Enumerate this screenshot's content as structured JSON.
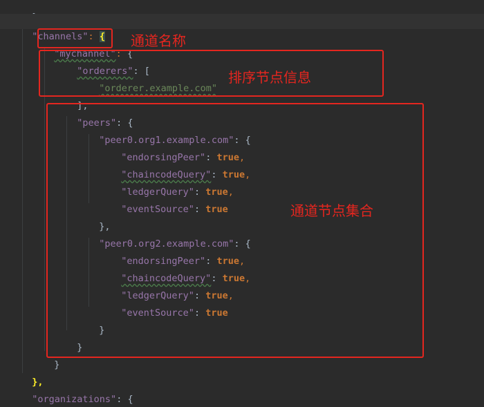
{
  "editor": {
    "lines": {
      "l0_close": "},",
      "l1_channels_key": "\"channels\"",
      "l1_colon": ": ",
      "l1_brace": "{",
      "l2_mychannel_key": "\"mychannel\"",
      "l2_colon": ": ",
      "l2_brace": "{",
      "l3_orderers_key": "\"orderers\"",
      "l3_rest": ": [",
      "l4_orderer_value": "\"orderer.example.com\"",
      "l5_close": "],",
      "l6_peers_key": "\"peers\"",
      "l6_rest": ": {",
      "l7_peer1_key": "\"peer0.org1.example.com\"",
      "l7_rest": ": {",
      "l8_key": "\"endorsingPeer\"",
      "l8_sep": ": ",
      "l8_val": "true",
      "l8_comma": ",",
      "l9_key": "\"chaincodeQuery\"",
      "l9_sep": ": ",
      "l9_val": "true",
      "l9_comma": ",",
      "l10_key": "\"ledgerQuery\"",
      "l10_sep": ": ",
      "l10_val": "true",
      "l10_comma": ",",
      "l11_key": "\"eventSource\"",
      "l11_sep": ": ",
      "l11_val": "true",
      "l12_close": "},",
      "l13_peer2_key": "\"peer0.org2.example.com\"",
      "l13_rest": ": {",
      "l14_key": "\"endorsingPeer\"",
      "l14_sep": ": ",
      "l14_val": "true",
      "l14_comma": ",",
      "l15_key": "\"chaincodeQuery\"",
      "l15_sep": ": ",
      "l15_val": "true",
      "l15_comma": ",",
      "l16_key": "\"ledgerQuery\"",
      "l16_sep": ": ",
      "l16_val": "true",
      "l16_comma": ",",
      "l17_key": "\"eventSource\"",
      "l17_sep": ": ",
      "l17_val": "true",
      "l18_close": "}",
      "l19_close": "}",
      "l20_close": "}",
      "l21_close": "},",
      "l22_organizations_key": "\"organizations\"",
      "l22_rest": ": {"
    }
  },
  "annotations": {
    "channel_name": "通道名称",
    "orderer_info": "排序节点信息",
    "peer_set": "通道节点集合"
  },
  "colors": {
    "background": "#2b2b2b",
    "annotation_red": "#e5261f",
    "json_key": "#9876aa",
    "json_string": "#6a8759",
    "json_keyword": "#cc7832"
  }
}
